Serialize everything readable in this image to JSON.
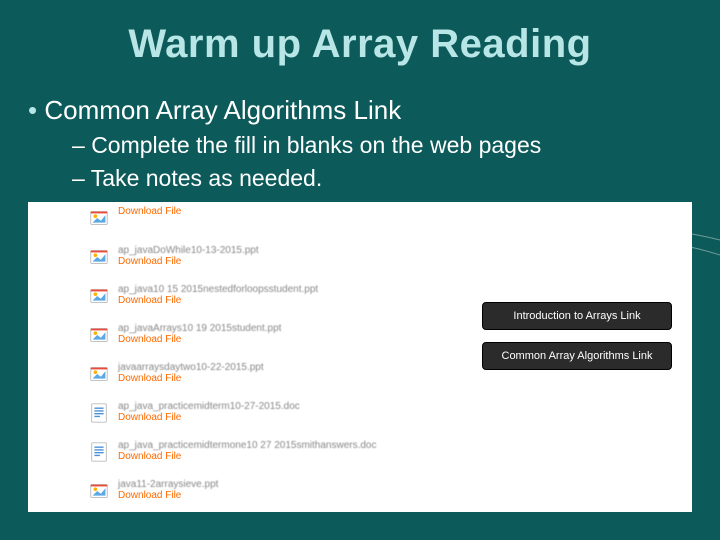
{
  "title": "Warm up Array Reading",
  "bullet1": "Common Array Algorithms Link",
  "sub1": "Complete the fill in blanks on the web pages",
  "sub2": "Take notes as needed.",
  "download_label": "Download File",
  "files": [
    {
      "name": "Download File",
      "type": "ppt",
      "show_name": false
    },
    {
      "name": "ap_javaDoWhile10-13-2015.ppt",
      "type": "ppt",
      "show_name": true
    },
    {
      "name": "ap_java10 15 2015nestedforloopsstudent.ppt",
      "type": "ppt",
      "show_name": true
    },
    {
      "name": "ap_javaArrays10 19 2015student.ppt",
      "type": "ppt",
      "show_name": true
    },
    {
      "name": "javaarraysdaytwo10-22-2015.ppt",
      "type": "ppt",
      "show_name": true
    },
    {
      "name": "ap_java_practicemidterm10-27-2015.doc",
      "type": "doc",
      "show_name": true
    },
    {
      "name": "ap_java_practicemidtermone10 27 2015smithanswers.doc",
      "type": "doc",
      "show_name": true
    },
    {
      "name": "java11-2arraysieve.ppt",
      "type": "ppt",
      "show_name": true
    }
  ],
  "buttons": {
    "intro": "Introduction to Arrays Link",
    "common": "Common Array Algorithms Link"
  }
}
